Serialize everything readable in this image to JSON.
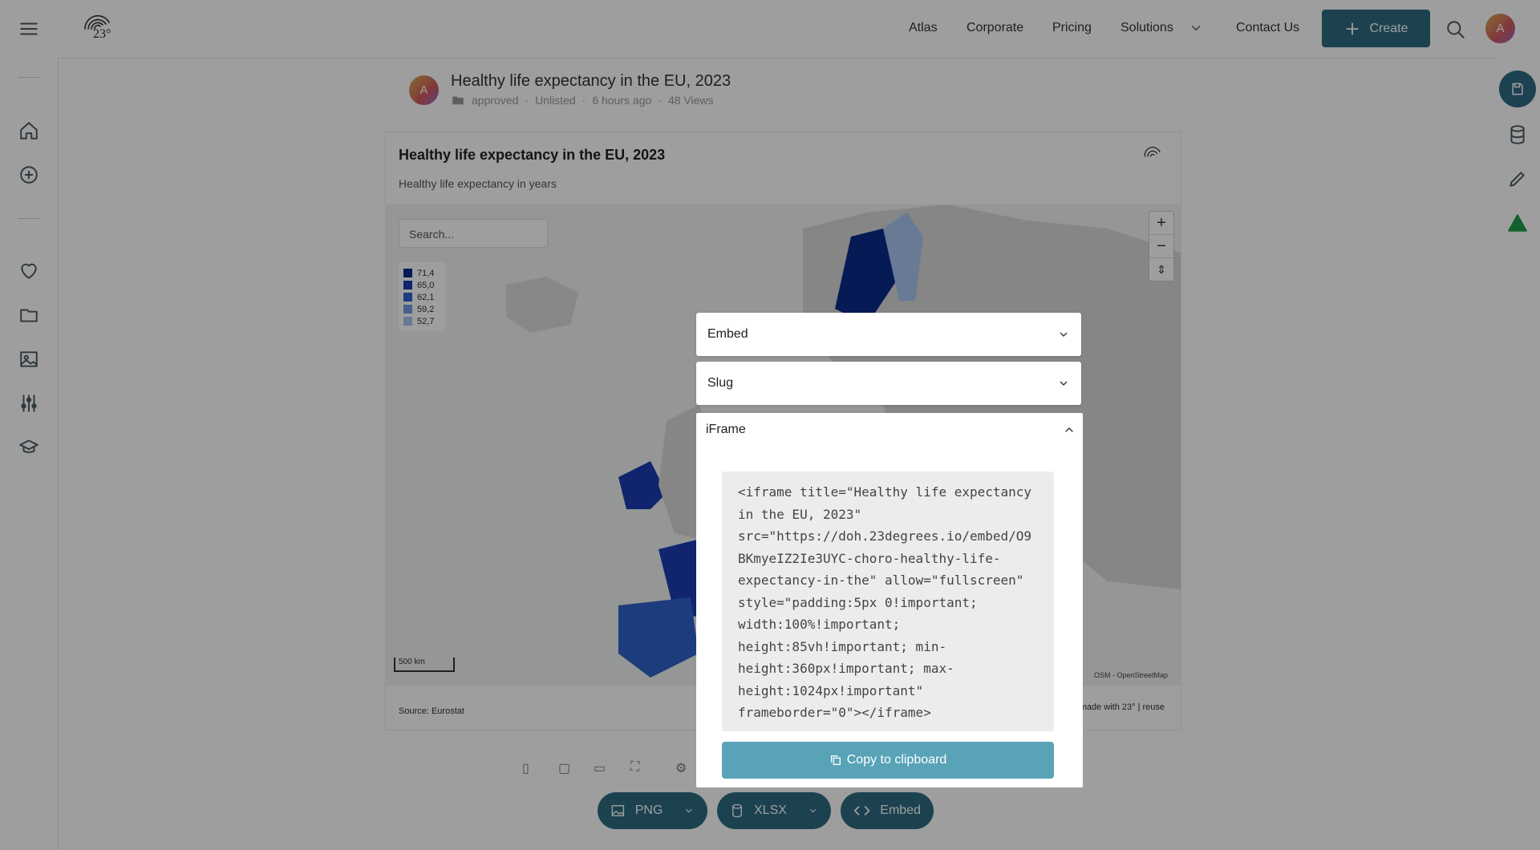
{
  "header": {
    "nav": [
      "Atlas",
      "Corporate",
      "Pricing",
      "Solutions",
      "Contact Us"
    ],
    "create_label": "Create",
    "avatar_initial": "A",
    "logo_text": "23°"
  },
  "post": {
    "avatar_initial": "A",
    "title": "Healthy life expectancy in the EU, 2023",
    "folder": "approved",
    "visibility": "Unlisted",
    "time": "6 hours ago",
    "views": "48 Views"
  },
  "card": {
    "title": "Healthy life expectancy in the EU, 2023",
    "subtitle": "Healthy life expectancy in years",
    "search_placeholder": "Search...",
    "legend": [
      {
        "label": "71,4",
        "color": "#0b2a8c"
      },
      {
        "label": "65,0",
        "color": "#1a3db0"
      },
      {
        "label": "62,1",
        "color": "#2f62cc"
      },
      {
        "label": "59,2",
        "color": "#6f9be0"
      },
      {
        "label": "52,7",
        "color": "#a9c6ef"
      }
    ],
    "scale": "500 km",
    "attribution": "OSM - OpenStreetMap",
    "source": "Source: Eurostat",
    "made_with": "made with 23° | reuse"
  },
  "modal": {
    "embed_label": "Embed",
    "slug_label": "Slug",
    "iframe_label": "iFrame",
    "code": "<iframe title=\"Healthy life expectancy\nin the EU, 2023\"\nsrc=\"https://doh.23degrees.io/embed/O9\nBKmyeIZ2Ie3UYC-choro-healthy-life-\nexpectancy-in-the\" allow=\"fullscreen\"\nstyle=\"padding:5px 0!important;\nwidth:100%!important;\nheight:85vh!important; min-\nheight:360px!important; max-\nheight:1024px!important\"\nframeborder=\"0\"></iframe>",
    "copy_label": "Copy to clipboard"
  },
  "downloads": {
    "png_label": "PNG",
    "xlsx_label": "XLSX",
    "embed_label": "Embed"
  }
}
